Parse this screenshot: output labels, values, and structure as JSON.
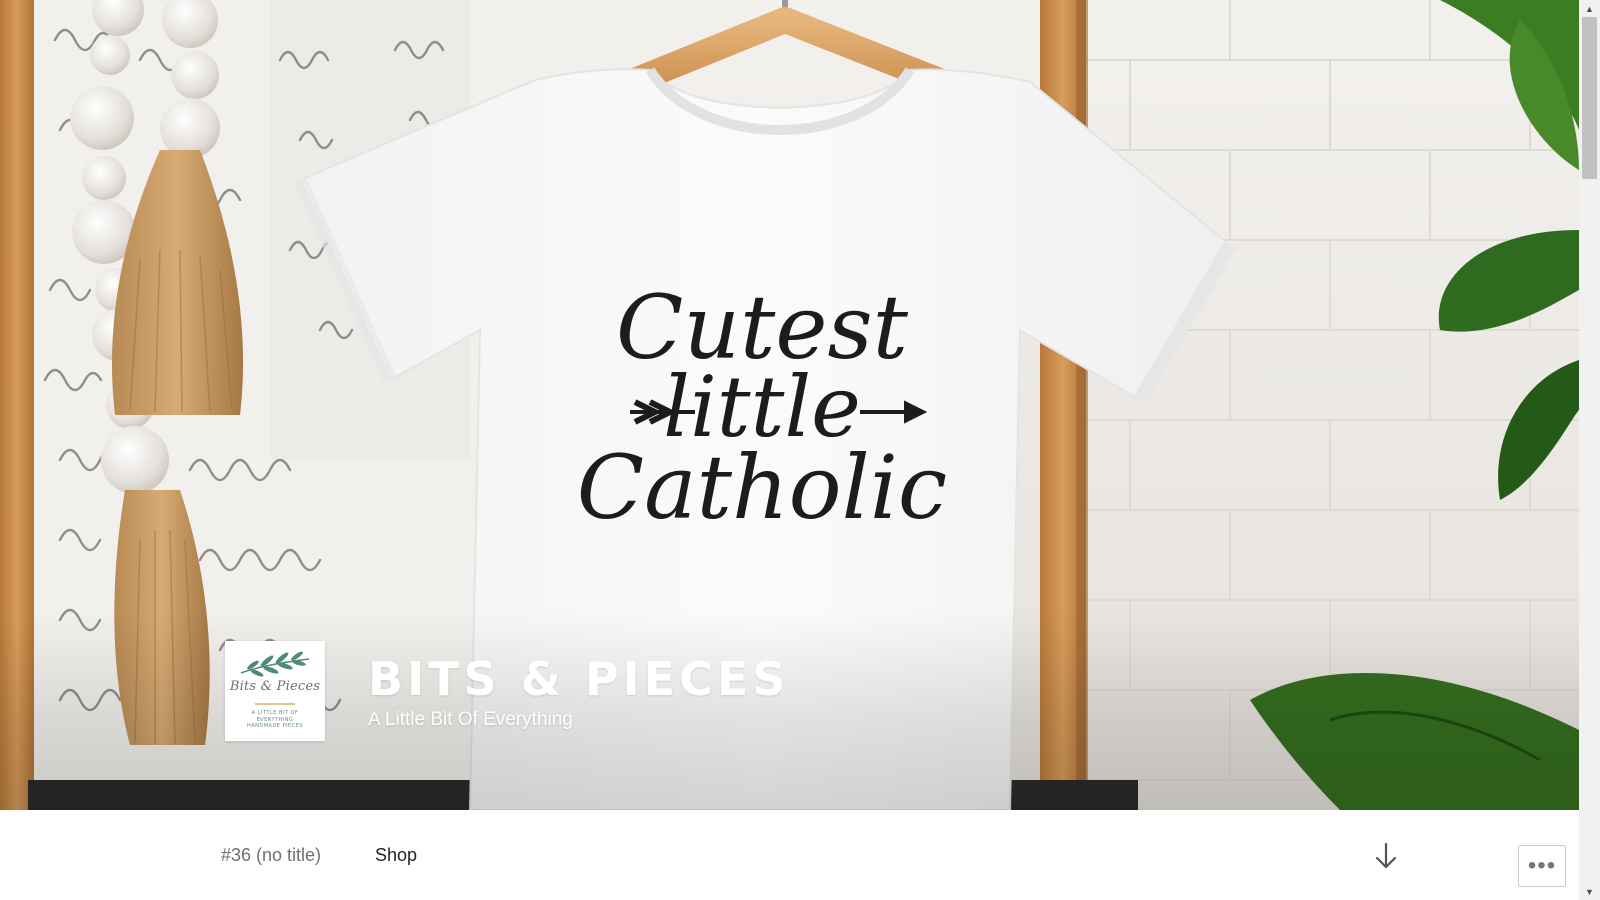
{
  "header": {
    "site_title": "BITS & PIECES",
    "tagline": "A Little Bit Of Everything",
    "logo": {
      "script_text": "Bits & Pieces",
      "sub_lines": [
        "A Little Bit Of",
        "Everything",
        "Handmade Pieces"
      ]
    },
    "hero_image": {
      "print_lines": [
        "Cutest",
        "little",
        "Catholic"
      ]
    }
  },
  "nav": {
    "items": [
      {
        "label": "#36 (no title)"
      },
      {
        "label": "Shop"
      }
    ],
    "scroll_down_icon": "arrow-down-icon",
    "more_label": "•••"
  },
  "scrollbar": {
    "up_arrow": "▲",
    "down_arrow": "▼"
  },
  "colors": {
    "nav_text": "#222222",
    "nav_muted": "#707070",
    "logo_leaf": "#4f8a73",
    "logo_accent": "#d9c690"
  }
}
